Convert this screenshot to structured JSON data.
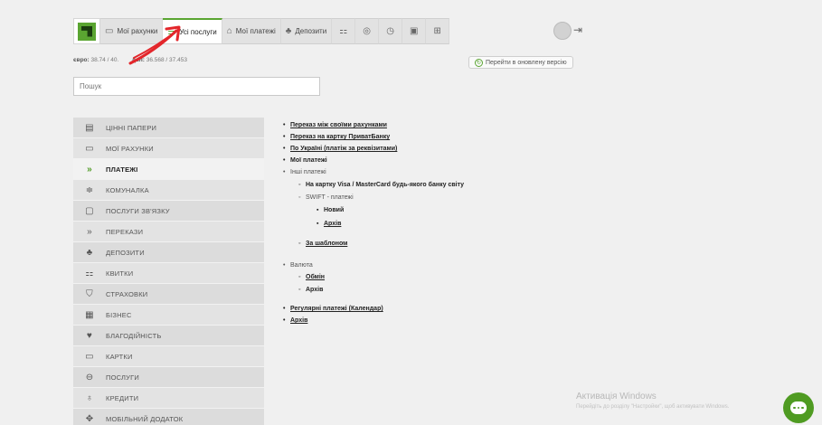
{
  "tabs": {
    "my_accounts": "Мої рахунки",
    "all_services": "Усі послуги",
    "my_payments": "Мої платежі",
    "deposits": "Депозити"
  },
  "rates": {
    "euro_label": "євро:",
    "euro_value": "38.74 / 40.",
    "usd_label": "дол:",
    "usd_value": "36.568 / 37.453"
  },
  "new_version_label": "Перейти в оновлену версію",
  "search": {
    "placeholder": "Пошук"
  },
  "sidebar": [
    "ЦІННІ ПАПЕРИ",
    "МОЇ РАХУНКИ",
    "ПЛАТЕЖІ",
    "КОМУНАЛКА",
    "ПОСЛУГИ ЗВ'ЯЗКУ",
    "ПЕРЕКАЗИ",
    "ДЕПОЗИТИ",
    "КВИТКИ",
    "СТРАХОВКИ",
    "БІЗНЕС",
    "БЛАГОДІЙНІСТЬ",
    "КАРТКИ",
    "ПОСЛУГИ",
    "КРЕДИТИ",
    "МОБІЛЬНИЙ ДОДАТОК"
  ],
  "menu": {
    "between_accounts": "Переказ між своїми рахунками",
    "to_privat_card": "Переказ на картку ПриватБанку",
    "by_requisites": "По Україні (платіж за реквізитами)",
    "my_payments": "Мої платежі",
    "other_payments": "Інші платежі",
    "to_visa_mc": "На картку Visa / MasterCard будь-якого банку світу",
    "swift": "SWIFT - платежі",
    "swift_new": "Новий",
    "swift_archive": "Архів",
    "by_template": "За шаблоном",
    "currency": "Валюта",
    "exchange": "Обмін",
    "currency_archive": "Архів",
    "regular": "Регулярні платежі (Календар)",
    "archive": "Архів"
  },
  "windows": {
    "title": "Активація Windows",
    "subtitle": "Перейдіть до розділу \"Настройки\", щоб активувати Windows."
  },
  "colors": {
    "accent": "#5aa531",
    "annotation": "#e3262b"
  }
}
